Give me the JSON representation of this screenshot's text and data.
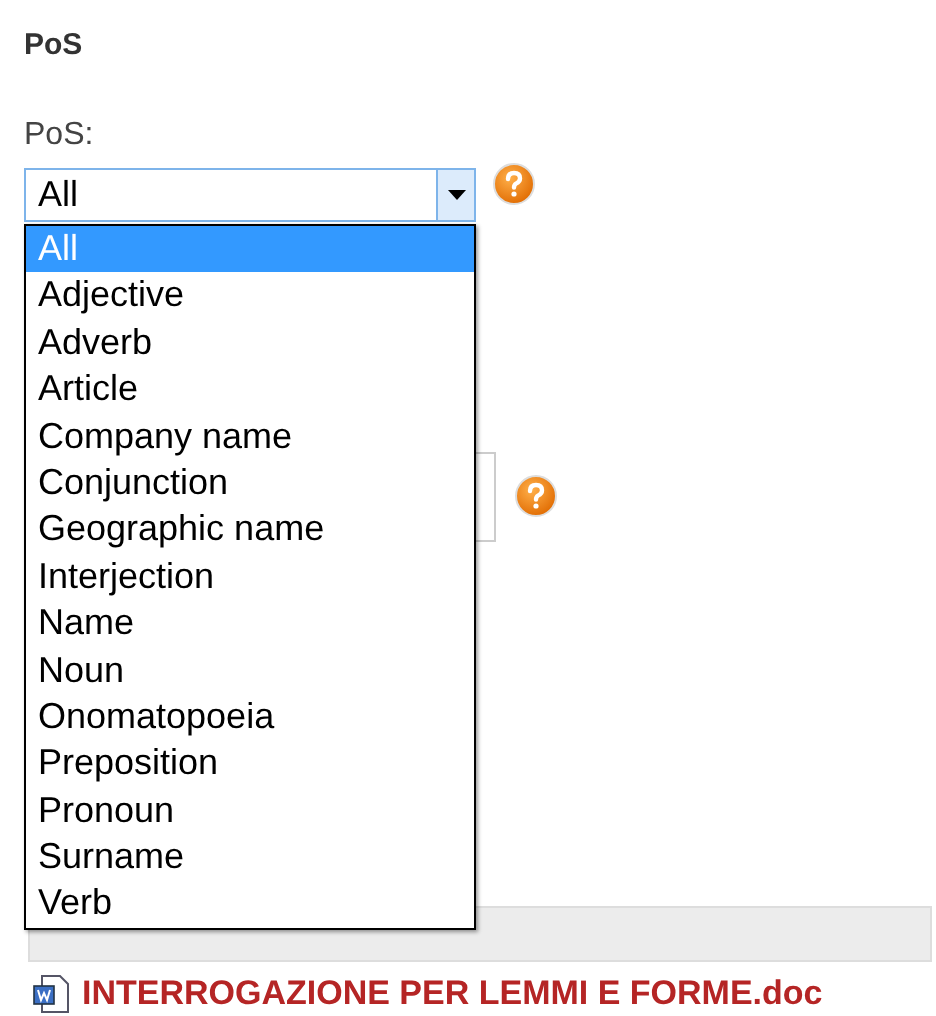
{
  "section_title": "PoS",
  "pos_field": {
    "label": "PoS:",
    "value": "All",
    "expanded": true,
    "options": [
      {
        "label": "All",
        "selected": true
      },
      {
        "label": "Adjective",
        "selected": false
      },
      {
        "label": "Adverb",
        "selected": false
      },
      {
        "label": "Article",
        "selected": false
      },
      {
        "label": "Company name",
        "selected": false
      },
      {
        "label": "Conjunction",
        "selected": false
      },
      {
        "label": "Geographic name",
        "selected": false
      },
      {
        "label": "Interjection",
        "selected": false
      },
      {
        "label": "Name",
        "selected": false
      },
      {
        "label": "Noun",
        "selected": false
      },
      {
        "label": "Onomatopoeia",
        "selected": false
      },
      {
        "label": "Preposition",
        "selected": false
      },
      {
        "label": "Pronoun",
        "selected": false
      },
      {
        "label": "Surname",
        "selected": false
      },
      {
        "label": "Verb",
        "selected": false
      }
    ]
  },
  "files": [
    {
      "name": "INTERROGAZIONE PER LEMMI E FORME.doc"
    }
  ]
}
